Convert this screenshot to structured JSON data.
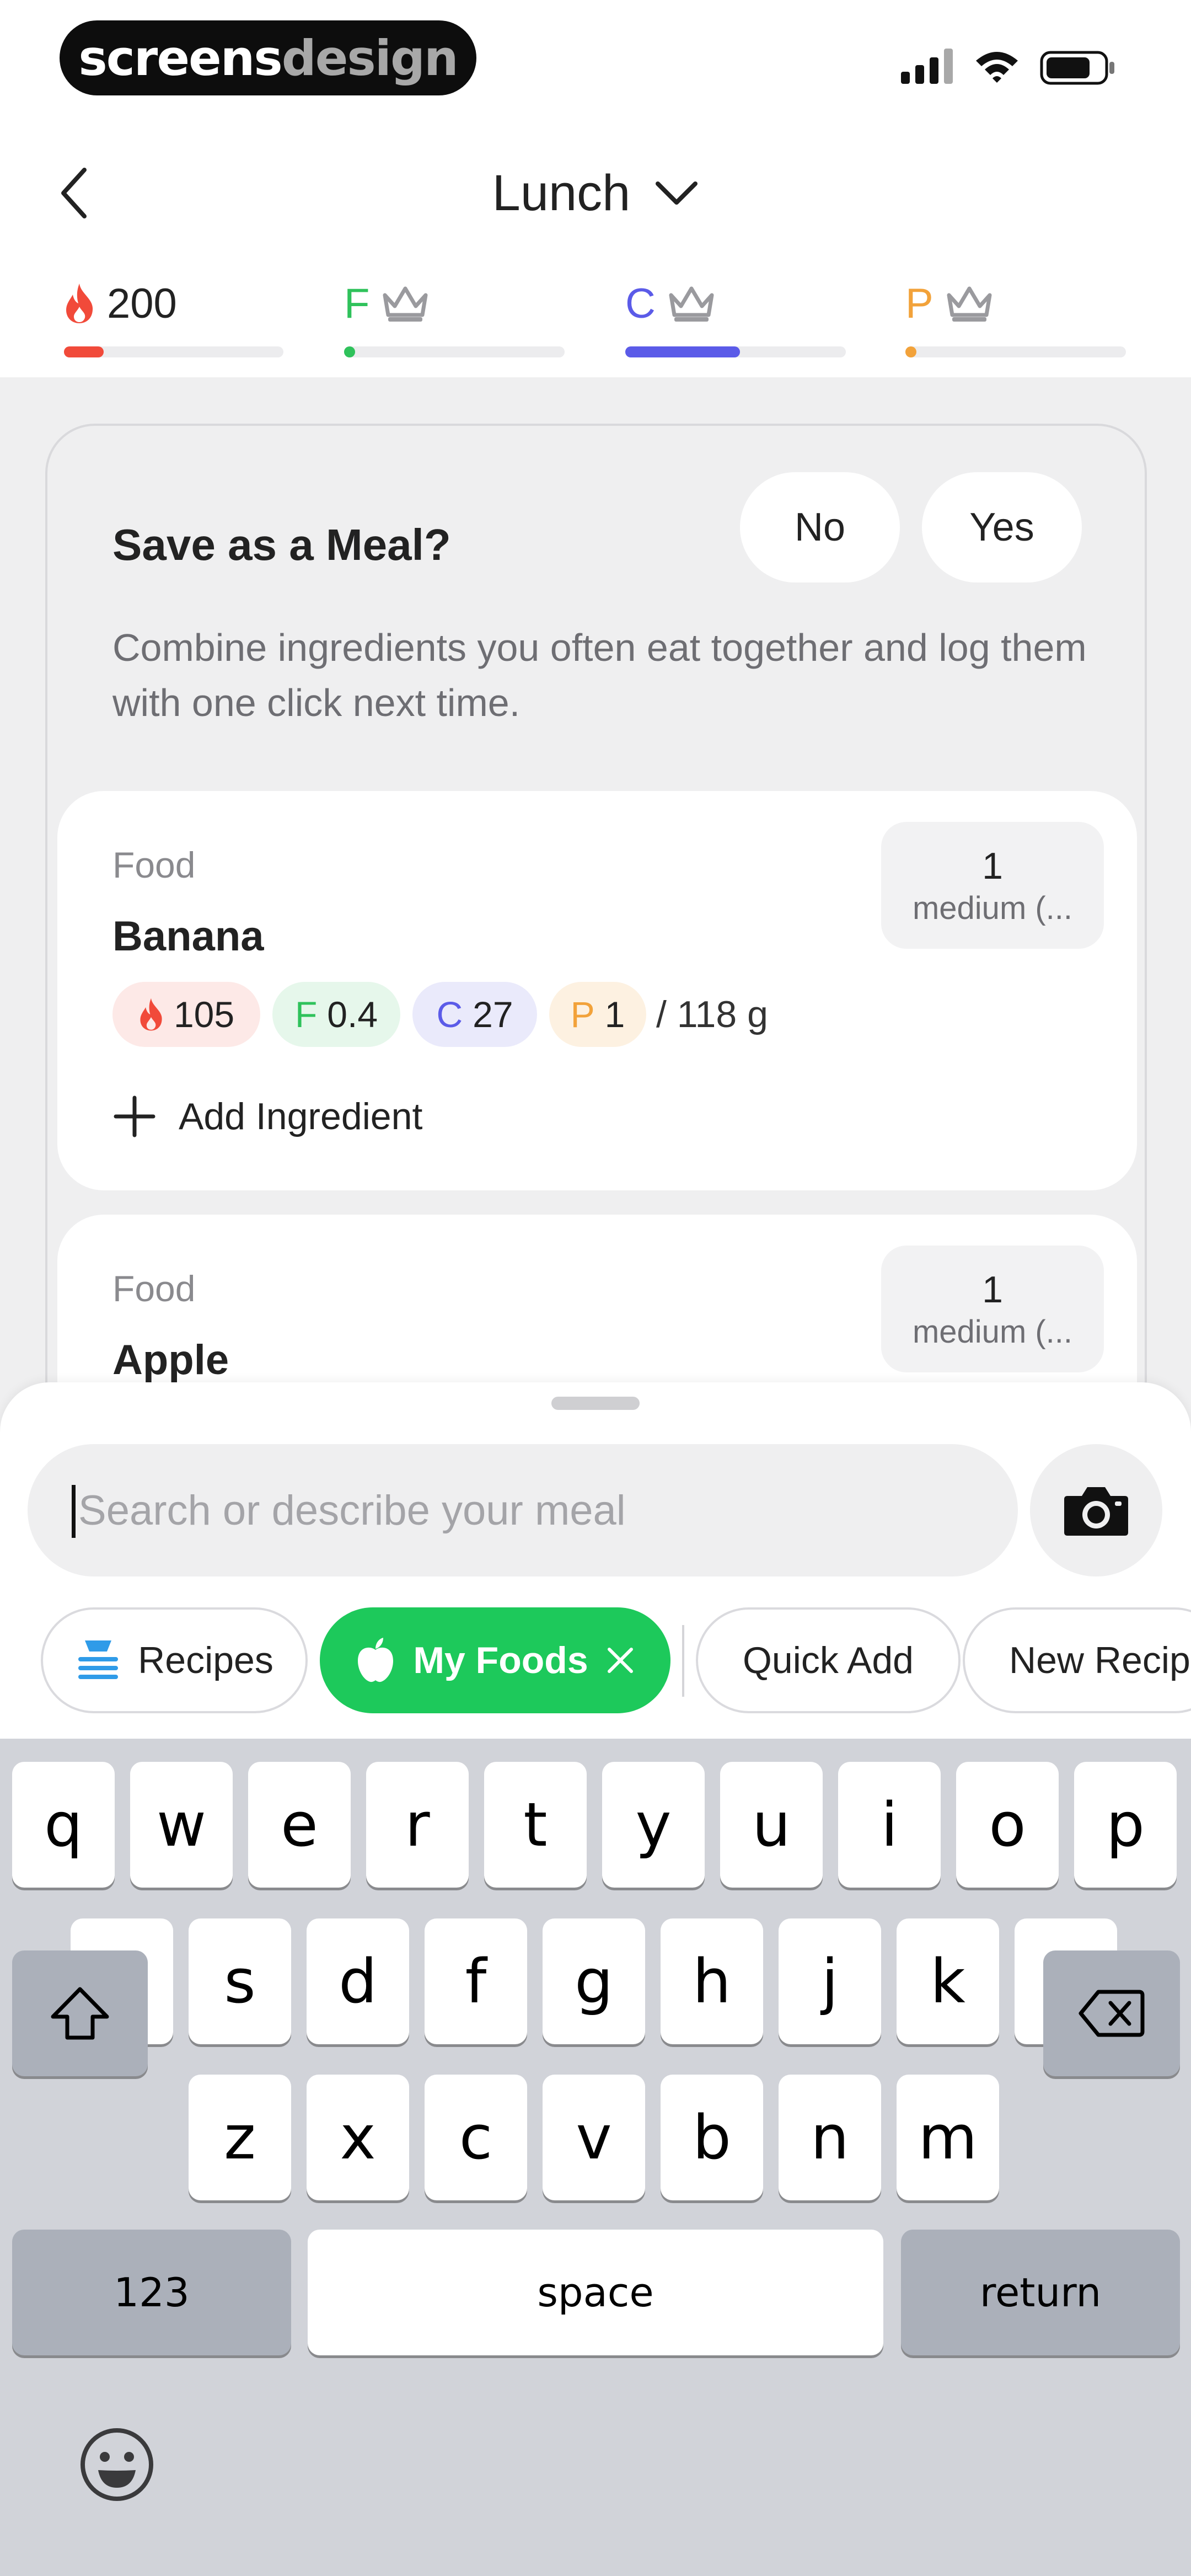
{
  "watermark": {
    "part1": "screens",
    "part2": "design"
  },
  "header": {
    "title": "Lunch",
    "macros": {
      "calories": {
        "value": "200",
        "progress": 0.18,
        "color": "#f14a3a"
      },
      "fat": {
        "letter": "F",
        "progress": 0.03,
        "color": "#2fc25b"
      },
      "carbs": {
        "letter": "C",
        "progress": 0.52,
        "color": "#5b5be8"
      },
      "protein": {
        "letter": "P",
        "progress": 0.03,
        "color": "#f2a23a"
      }
    }
  },
  "save_meal": {
    "question": "Save as a Meal?",
    "no_label": "No",
    "yes_label": "Yes",
    "description": "Combine ingredients you often eat together and log them with one click next time."
  },
  "foods": [
    {
      "label": "Food",
      "name": "Banana",
      "quantity": "1",
      "unit": "medium (...",
      "calories": "105",
      "fat": "0.4",
      "carbs": "27",
      "protein": "1",
      "serving": "/ 118 g",
      "add_ingredient": "Add Ingredient"
    },
    {
      "label": "Food",
      "name": "Apple",
      "quantity": "1",
      "unit": "medium (..."
    }
  ],
  "search": {
    "placeholder": "Search or describe your meal"
  },
  "filters": {
    "recipes": "Recipes",
    "my_foods": "My Foods",
    "quick_add": "Quick Add",
    "new_recipe": "New Recip"
  },
  "keyboard": {
    "row1": [
      "q",
      "w",
      "e",
      "r",
      "t",
      "y",
      "u",
      "i",
      "o",
      "p"
    ],
    "row2": [
      "a",
      "s",
      "d",
      "f",
      "g",
      "h",
      "j",
      "k",
      "l"
    ],
    "row3": [
      "z",
      "x",
      "c",
      "v",
      "b",
      "n",
      "m"
    ],
    "numbers_label": "123",
    "space_label": "space",
    "return_label": "return"
  },
  "colors": {
    "green_accent": "#1dc95b",
    "calorie_red": "#f14a3a",
    "carb_blue": "#5b5be8",
    "fat_green": "#2fc25b",
    "protein_orange": "#f2a23a"
  },
  "icons": [
    "back-chevron-icon",
    "chevron-down-icon",
    "flame-icon",
    "crown-icon",
    "plus-icon",
    "camera-icon",
    "recipes-icon",
    "apple-icon",
    "close-icon",
    "shift-icon",
    "delete-icon",
    "emoji-icon"
  ]
}
